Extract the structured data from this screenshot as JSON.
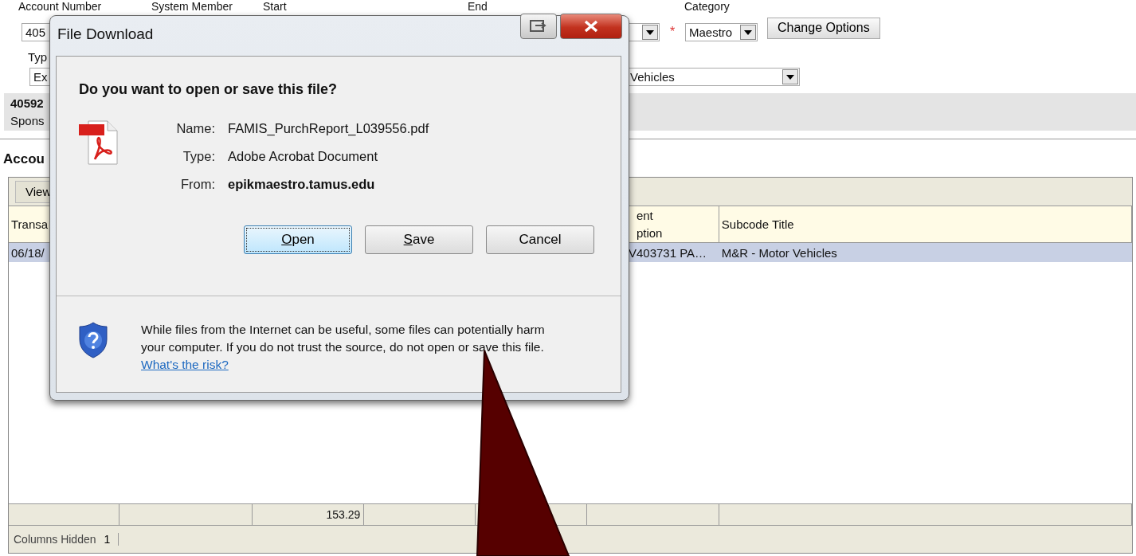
{
  "filters": {
    "account_label": "Account Number",
    "system_member_label": "System Member",
    "start_label": "Start",
    "end_label": "End",
    "category_label": "Category",
    "account_value": "405",
    "category_required_mark": "*",
    "category_value": "Maestro",
    "change_button": "Change Options",
    "type_label": "Typ",
    "type_value": "Ex",
    "subcode_value": "Vehicles"
  },
  "info": {
    "account": "40592",
    "sponsor": "Spons"
  },
  "section_title": "Accou",
  "table": {
    "toolbar_button": "View",
    "columns": [
      {
        "label": "Transa"
      },
      {},
      {},
      {},
      {},
      {
        "label": "ent\nption"
      },
      {
        "label": "Subcode Title"
      }
    ],
    "rows": [
      {
        "selected": true,
        "cells": [
          "06/18/",
          null,
          null,
          null,
          null,
          "V403731 PA…",
          "M&R - Motor Vehicles"
        ]
      }
    ],
    "totals": {
      "column_3": "153.29"
    }
  },
  "status_bar": {
    "label": "Columns Hidden",
    "value": "1"
  },
  "dialog": {
    "title": "File Download",
    "question": "Do you want to open or save this file?",
    "fields": [
      {
        "label": "Name:",
        "value": "FAMIS_PurchReport_L039556.pdf",
        "bold": false
      },
      {
        "label": "Type:",
        "value": "Adobe Acrobat Document",
        "bold": false
      },
      {
        "label": "From:",
        "value": "epikmaestro.tamus.edu",
        "bold": true
      }
    ],
    "buttons": [
      {
        "label": "Open",
        "underline_first": true,
        "default": true
      },
      {
        "label": "Save",
        "underline_first": true,
        "default": false
      },
      {
        "label": "Cancel",
        "underline_first": false,
        "default": false
      }
    ],
    "warning": "While files from the Internet can be useful, some files can potentially harm your computer. If you do not trust the source, do not open or save this file.",
    "risk_link": "What's the risk?"
  }
}
